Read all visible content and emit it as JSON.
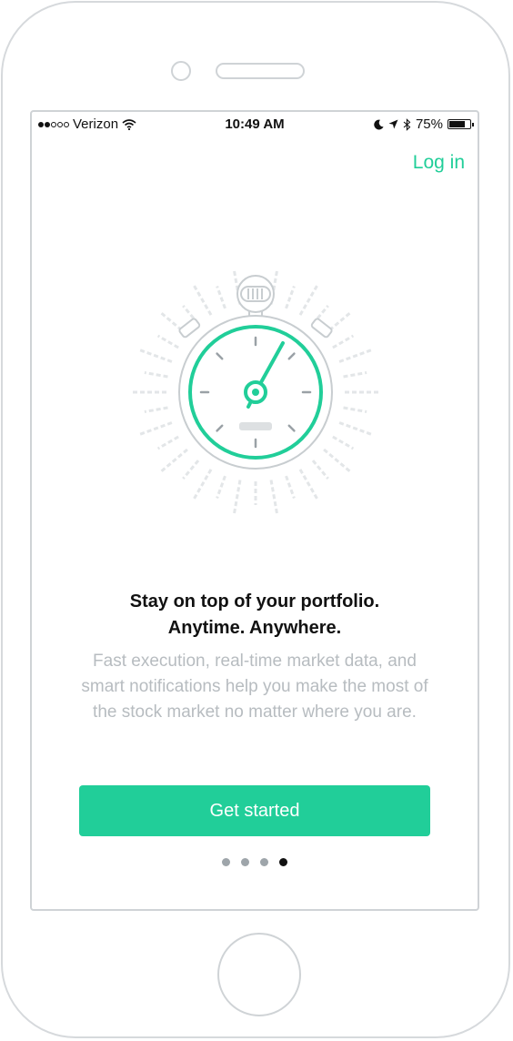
{
  "status_bar": {
    "carrier": "Verizon",
    "time": "10:49 AM",
    "battery": "75%",
    "battery_level": 0.75,
    "icons": [
      "signal-dots-icon",
      "wifi-icon",
      "moon-icon",
      "location-arrow-icon",
      "bluetooth-icon",
      "battery-icon"
    ]
  },
  "header": {
    "login_label": "Log in"
  },
  "hero": {
    "icon": "stopwatch-illustration",
    "headline_line1": "Stay on top of your portfolio.",
    "headline_line2": "Anytime. Anywhere.",
    "body_line1": "Fast execution, real-time market data, and",
    "body_line2": "smart notifications help you make the most of",
    "body_line3": "the stock market no matter where you are."
  },
  "cta": {
    "label": "Get started"
  },
  "pager": {
    "total": 4,
    "active_index": 3
  },
  "colors": {
    "accent": "#21ce99",
    "muted_text": "#b7bcc0",
    "frame": "#cfd3d6"
  }
}
